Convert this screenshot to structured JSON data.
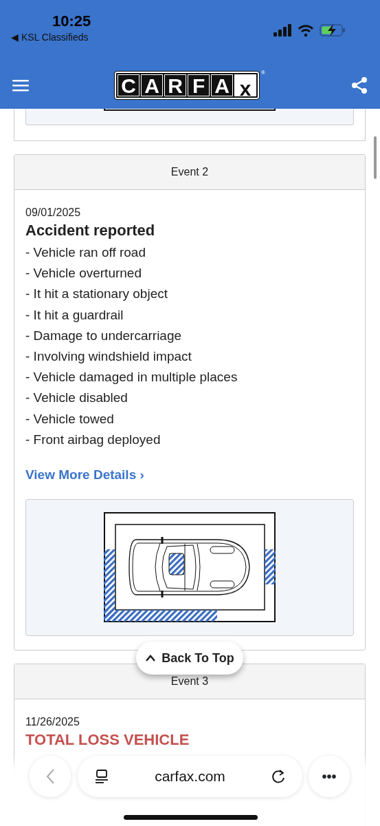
{
  "status_bar": {
    "time": "10:25",
    "back_arrow": "◀",
    "back_app": "KSL Classifieds"
  },
  "header": {
    "logo_letters": [
      "C",
      "A",
      "R",
      "F",
      "A",
      "x"
    ],
    "logo_mark": "®"
  },
  "events": [
    {
      "title": "Event 2",
      "date": "09/01/2025",
      "headline": "Accident reported",
      "alert": false,
      "details": [
        "- Vehicle ran off road",
        "- Vehicle overturned",
        "- It hit a stationary object",
        "- It hit a guardrail",
        "- Damage to undercarriage",
        "- Involving windshield impact",
        "- Vehicle damaged in multiple places",
        "- Vehicle disabled",
        "- Vehicle towed",
        "- Front airbag deployed"
      ],
      "link": "View More Details",
      "link_arrow": "›",
      "diagram": {
        "zones": [
          {
            "kind": "left",
            "damaged": true
          },
          {
            "kind": "rear-left",
            "damaged": true
          },
          {
            "kind": "rear-right",
            "damaged": false
          },
          {
            "kind": "right",
            "damaged": true
          },
          {
            "kind": "roof",
            "damaged": true
          }
        ]
      }
    },
    {
      "title": "Event 3",
      "date": "11/26/2025",
      "headline": "TOTAL LOSS VEHICLE",
      "alert": true
    }
  ],
  "back_to_top": {
    "label": "Back To Top"
  },
  "browser_bar": {
    "url": "carfax.com",
    "more": "•••"
  }
}
